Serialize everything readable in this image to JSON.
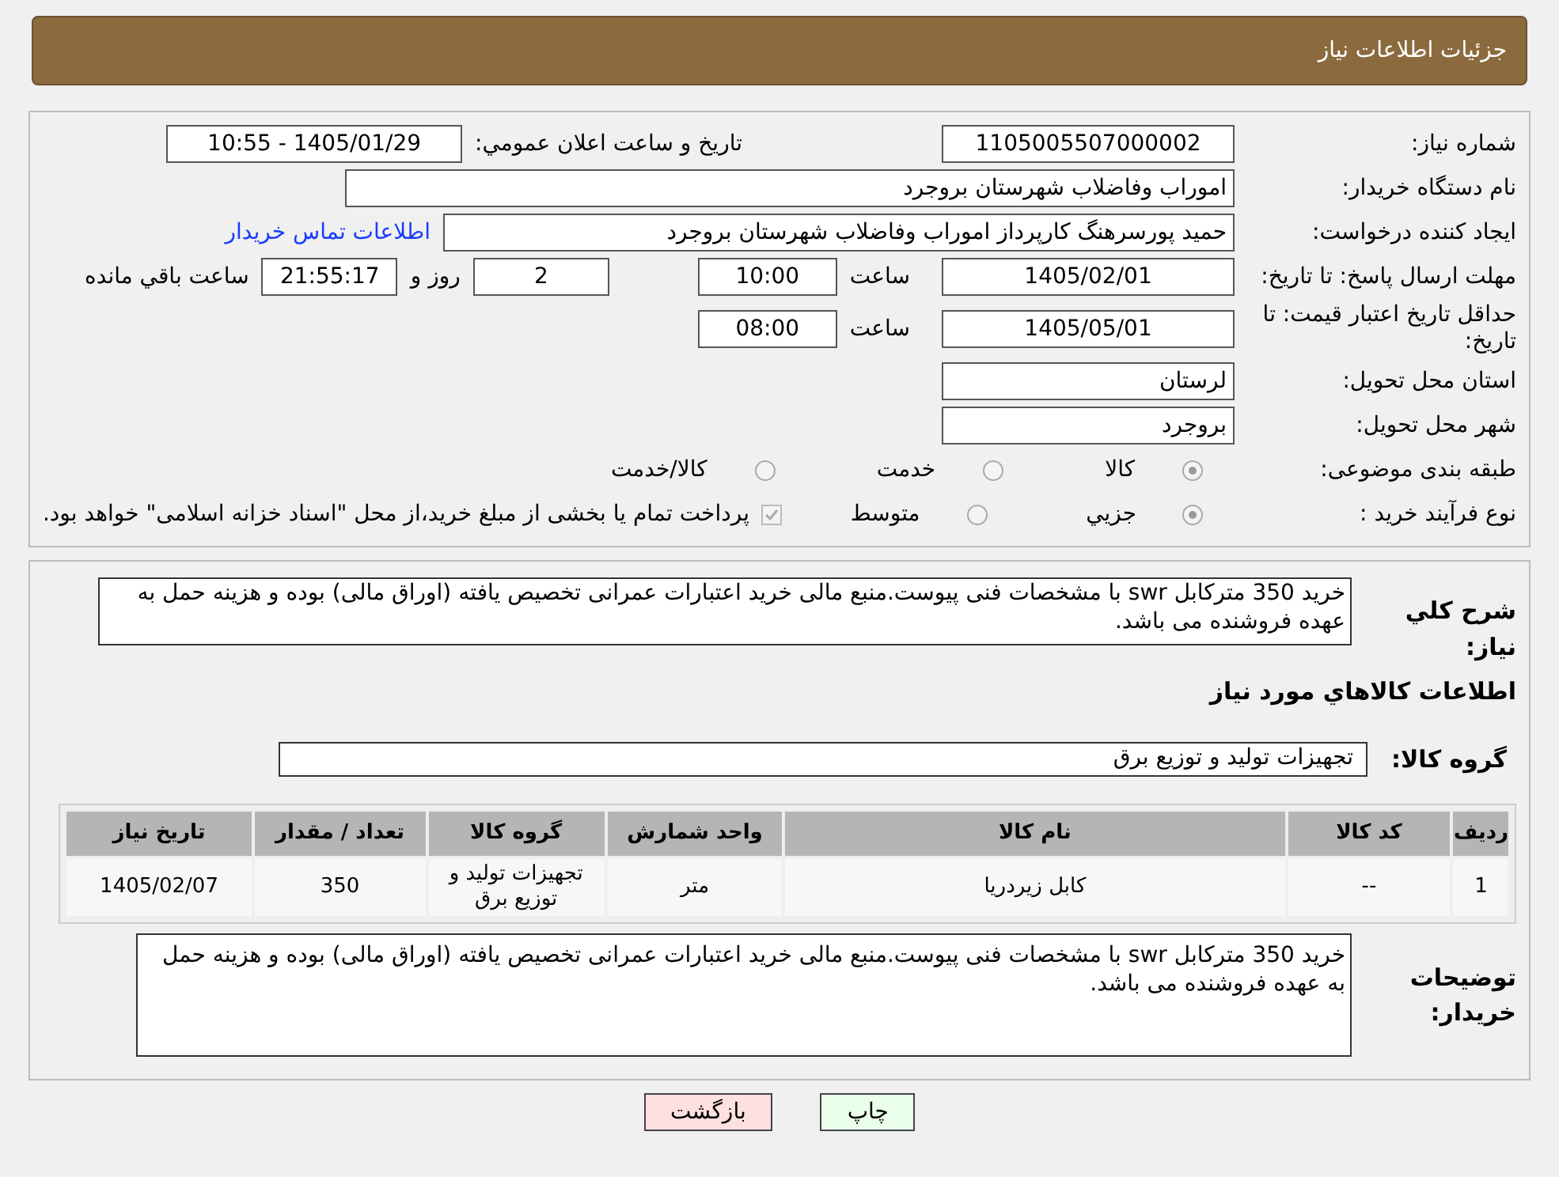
{
  "header": {
    "title": "جزئیات اطلاعات نیاز"
  },
  "need_number": {
    "label": "شماره نیاز:",
    "value": "1105005507000002"
  },
  "announce": {
    "label": "تاریخ و ساعت اعلان عمومي:",
    "value": "1405/01/29 - 10:55"
  },
  "buyer_org": {
    "label": "نام دستگاه خریدار:",
    "value": "اموراب وفاضلاب شهرستان بروجرد"
  },
  "requester": {
    "label": "ایجاد کننده درخواست:",
    "value": "حمید پورسرهنگ کارپرداز اموراب وفاضلاب شهرستان بروجرد",
    "link": "اطلاعات تماس خریدار"
  },
  "response_deadline": {
    "label": "مهلت ارسال پاسخ: تا تاریخ:",
    "date": "1405/02/01",
    "time_label": "ساعت",
    "time": "10:00",
    "days": "2",
    "days_label": "روز و",
    "remaining": "21:55:17",
    "remaining_label": "ساعت باقي مانده"
  },
  "price_validity": {
    "label": "حداقل تاریخ اعتبار قیمت: تا تاریخ:",
    "date": "1405/05/01",
    "time_label": "ساعت",
    "time": "08:00"
  },
  "province": {
    "label": "استان محل تحویل:",
    "value": "لرستان"
  },
  "city": {
    "label": "شهر محل تحویل:",
    "value": "بروجرد"
  },
  "category": {
    "label": "طبقه بندی موضوعی:",
    "options": [
      {
        "label": "کالا",
        "selected": true
      },
      {
        "label": "خدمت",
        "selected": false
      },
      {
        "label": "کالا/خدمت",
        "selected": false
      }
    ]
  },
  "purchase_type": {
    "label": "نوع فرآیند خرید :",
    "options": [
      {
        "label": "جزيي",
        "selected": true
      },
      {
        "label": "متوسط",
        "selected": false
      }
    ],
    "note": {
      "text": "پرداخت تمام یا بخشی از مبلغ خرید،از محل \"اسناد خزانه اسلامی\" خواهد بود.",
      "checked": true
    }
  },
  "description": {
    "label": "شرح کلي نیاز:",
    "value": "خرید 350 مترکابل swr با  مشخصات فنی پیوست.منبع مالی خرید اعتبارات عمرانی تخصیص یافته (اوراق مالی) بوده و هزینه حمل به عهده فروشنده می باشد."
  },
  "goods_title": "اطلاعات کالاهاي مورد نیاز",
  "goods_group": {
    "label": "گروه کالا:",
    "value": "تجهیزات تولید و توزیع برق"
  },
  "table": {
    "columns": [
      "ردیف",
      "کد کالا",
      "نام کالا",
      "واحد شمارش",
      "گروه کالا",
      "تعداد / مقدار",
      "تاریخ نیاز"
    ],
    "rows": [
      [
        "1",
        "--",
        "کابل زیردریا",
        "متر",
        "تجهیزات تولید و توزیع برق",
        "350",
        "1405/02/07"
      ]
    ]
  },
  "buyer_notes": {
    "label": "توضیحات خریدار:",
    "value": "خرید 350 مترکابل swr با  مشخصات فنی پیوست.منبع مالی خرید اعتبارات عمرانی تخصیص یافته (اوراق مالی) بوده و هزینه حمل به عهده فروشنده می باشد."
  },
  "buttons": [
    {
      "label": "چاپ",
      "kind": "print"
    },
    {
      "label": "بازگشت",
      "kind": "back"
    }
  ]
}
